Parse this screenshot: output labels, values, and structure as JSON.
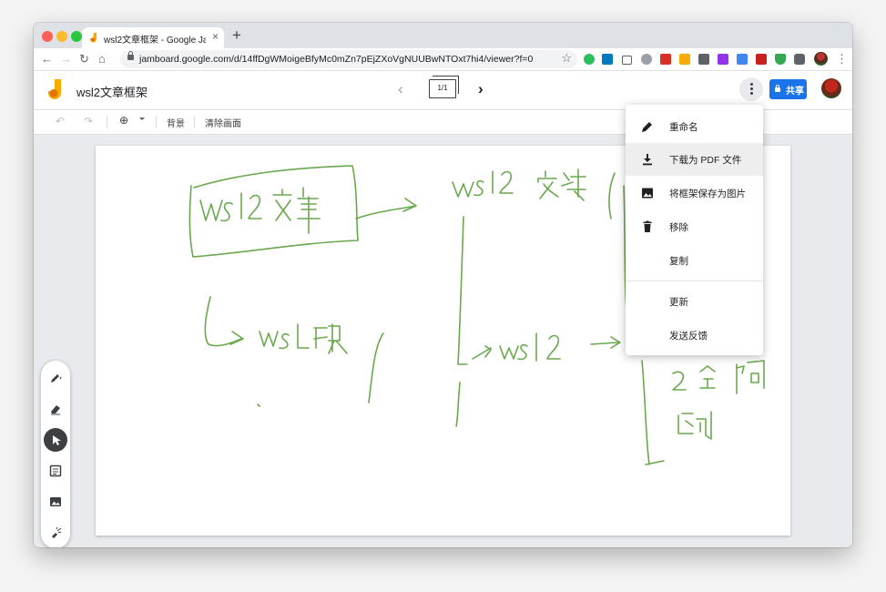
{
  "browser": {
    "tab_title": "wsl2文章框架 - Google Jamboard",
    "new_tab_symbol": "+",
    "close_symbol": "×",
    "url": "jamboard.google.com/d/14ffDgWMoigeBfyMc0mZn7pEjZXoVgNUUBwNTOxt7hi4/viewer?f=0",
    "extension_icons": [
      "evernote-icon",
      "trello-icon",
      "mail-icon",
      "extension-icon-a",
      "extension-icon-b",
      "extension-icon-c",
      "extension-icon-d",
      "extension-icon-e",
      "extension-icon-f",
      "extension-icon-g",
      "extension-icon-h",
      "shield-icon",
      "puzzle-icon"
    ]
  },
  "app": {
    "doc_title": "wsl2文章框架",
    "frame_indicator": "1/1",
    "share_label": "共享",
    "accent_color": "#1a73e8",
    "logo_color": "#f9ab00"
  },
  "toolbar": {
    "background_label": "背景",
    "clear_label": "清除画面"
  },
  "tools": [
    "pen-icon",
    "eraser-icon",
    "select-icon",
    "sticky-note-icon",
    "image-icon",
    "laser-icon"
  ],
  "menu": {
    "items": [
      {
        "label": "重命名",
        "icon": "pencil-icon"
      },
      {
        "label": "下载为 PDF 文件",
        "icon": "download-icon"
      },
      {
        "label": "将框架保存为图片",
        "icon": "image-icon"
      },
      {
        "label": "移除",
        "icon": "trash-icon"
      },
      {
        "label": "复制",
        "icon": ""
      },
      {
        "label": "更新",
        "icon": ""
      },
      {
        "label": "发送反馈",
        "icon": ""
      }
    ]
  },
  "board": {
    "ink_color": "#6aa84f"
  }
}
